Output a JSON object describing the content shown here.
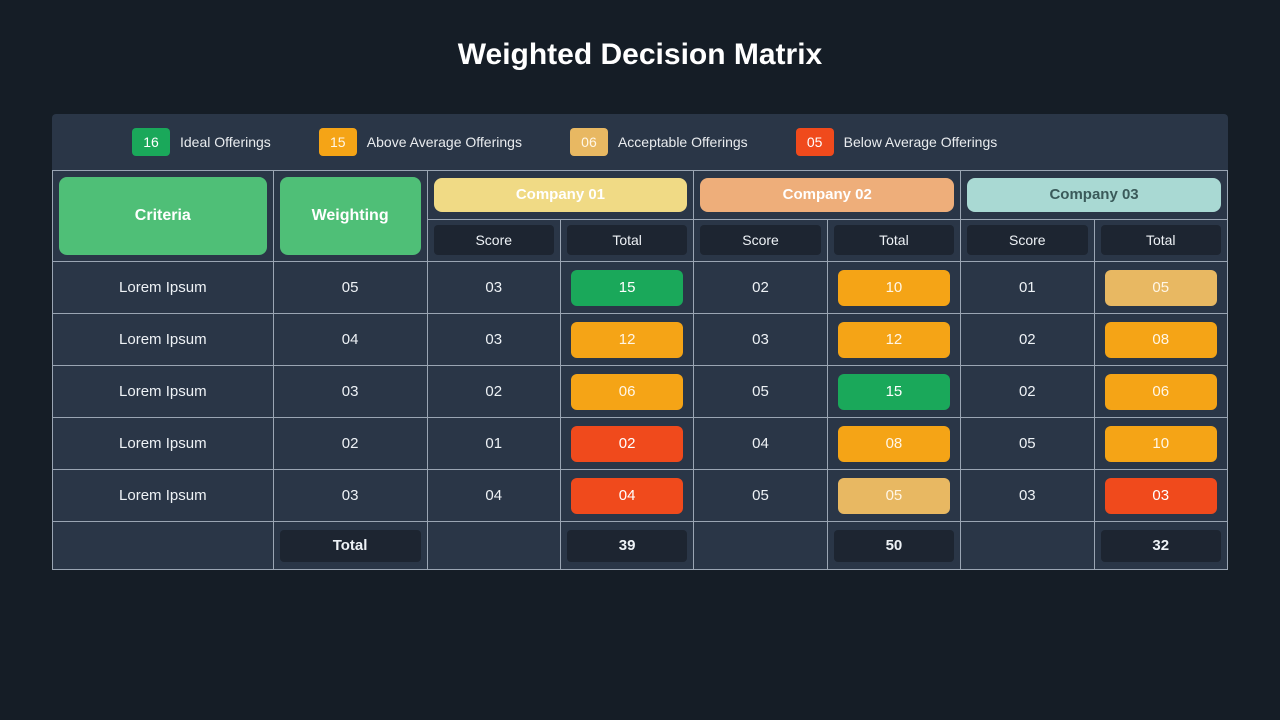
{
  "title": "Weighted Decision Matrix",
  "legend": [
    {
      "value": "16",
      "label": "Ideal Offerings",
      "cls": "chip-green"
    },
    {
      "value": "15",
      "label": "Above Average Offerings",
      "cls": "chip-orange"
    },
    {
      "value": "06",
      "label": "Acceptable Offerings",
      "cls": "chip-sand"
    },
    {
      "value": "05",
      "label": "Below Average Offerings",
      "cls": "chip-red"
    }
  ],
  "header": {
    "criteria": "Criteria",
    "weighting": "Weighting",
    "companies": [
      "Company 01",
      "Company 02",
      "Company 03"
    ],
    "score": "Score",
    "total": "Total"
  },
  "rows": [
    {
      "criteria": "Lorem Ipsum",
      "weight": "05",
      "c": [
        {
          "score": "03",
          "total": "15",
          "cls": "chip-green"
        },
        {
          "score": "02",
          "total": "10",
          "cls": "chip-orange"
        },
        {
          "score": "01",
          "total": "05",
          "cls": "chip-sand"
        }
      ]
    },
    {
      "criteria": "Lorem Ipsum",
      "weight": "04",
      "c": [
        {
          "score": "03",
          "total": "12",
          "cls": "chip-orange"
        },
        {
          "score": "03",
          "total": "12",
          "cls": "chip-orange"
        },
        {
          "score": "02",
          "total": "08",
          "cls": "chip-orange"
        }
      ]
    },
    {
      "criteria": "Lorem Ipsum",
      "weight": "03",
      "c": [
        {
          "score": "02",
          "total": "06",
          "cls": "chip-orange"
        },
        {
          "score": "05",
          "total": "15",
          "cls": "chip-green"
        },
        {
          "score": "02",
          "total": "06",
          "cls": "chip-orange"
        }
      ]
    },
    {
      "criteria": "Lorem Ipsum",
      "weight": "02",
      "c": [
        {
          "score": "01",
          "total": "02",
          "cls": "chip-red"
        },
        {
          "score": "04",
          "total": "08",
          "cls": "chip-orange"
        },
        {
          "score": "05",
          "total": "10",
          "cls": "chip-orange"
        }
      ]
    },
    {
      "criteria": "Lorem Ipsum",
      "weight": "03",
      "c": [
        {
          "score": "04",
          "total": "04",
          "cls": "chip-red"
        },
        {
          "score": "05",
          "total": "05",
          "cls": "chip-sand"
        },
        {
          "score": "03",
          "total": "03",
          "cls": "chip-red"
        }
      ]
    }
  ],
  "footer": {
    "label": "Total",
    "totals": [
      "39",
      "50",
      "32"
    ]
  }
}
